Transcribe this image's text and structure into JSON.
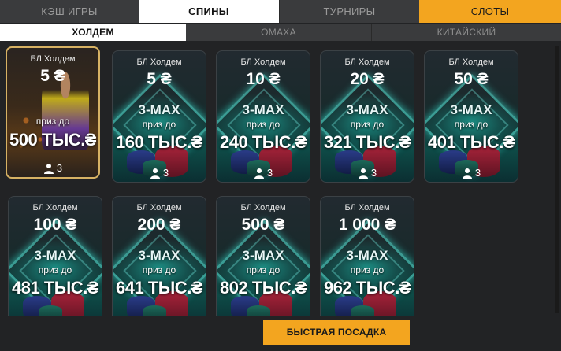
{
  "top_tabs": [
    {
      "label": "КЭШ ИГРЫ"
    },
    {
      "label": "СПИНЫ"
    },
    {
      "label": "ТУРНИРЫ"
    },
    {
      "label": "СЛОТЫ"
    }
  ],
  "sub_tabs": [
    {
      "label": "ХОЛДЕМ"
    },
    {
      "label": "ОМАХА"
    },
    {
      "label": "КИТАЙСКИЙ"
    }
  ],
  "colors": {
    "accent": "#f3a51f",
    "active_tab": "#ffffff",
    "featured_border": "#d7b264",
    "card_glow": "#20d0be"
  },
  "cards": [
    {
      "game": "БЛ Холдем",
      "stake": "5 ₴",
      "badge": "",
      "prize_label": "приз до",
      "prize": "500 ТЫС.₴",
      "players": "3",
      "featured": true
    },
    {
      "game": "БЛ Холдем",
      "stake": "5 ₴",
      "badge": "3-MAX",
      "prize_label": "приз до",
      "prize": "160 ТЫС.₴",
      "players": "3"
    },
    {
      "game": "БЛ Холдем",
      "stake": "10 ₴",
      "badge": "3-MAX",
      "prize_label": "приз до",
      "prize": "240 ТЫС.₴",
      "players": "3"
    },
    {
      "game": "БЛ Холдем",
      "stake": "20 ₴",
      "badge": "3-MAX",
      "prize_label": "приз до",
      "prize": "321 ТЫС.₴",
      "players": "3"
    },
    {
      "game": "БЛ Холдем",
      "stake": "50 ₴",
      "badge": "3-MAX",
      "prize_label": "приз до",
      "prize": "401 ТЫС.₴",
      "players": "3"
    },
    {
      "game": "БЛ Холдем",
      "stake": "100 ₴",
      "badge": "3-MAX",
      "prize_label": "приз до",
      "prize": "481 ТЫС.₴"
    },
    {
      "game": "БЛ Холдем",
      "stake": "200 ₴",
      "badge": "3-MAX",
      "prize_label": "приз до",
      "prize": "641 ТЫС.₴"
    },
    {
      "game": "БЛ Холдем",
      "stake": "500 ₴",
      "badge": "3-MAX",
      "prize_label": "приз до",
      "prize": "802 ТЫС.₴"
    },
    {
      "game": "БЛ Холдем",
      "stake": "1 000 ₴",
      "badge": "3-MAX",
      "prize_label": "приз до",
      "prize": "962 ТЫС.₴"
    }
  ],
  "quick_seat_label": "БЫСТРАЯ ПОСАДКА"
}
